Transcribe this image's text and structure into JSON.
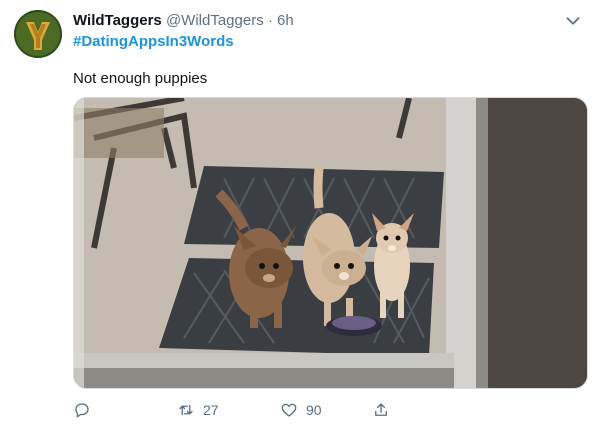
{
  "tweet": {
    "author_name": "WildTaggers",
    "author_handle": "@WildTaggers",
    "separator": "·",
    "time": "6h",
    "hashtag": "#DatingAppsIn3Words",
    "text": "Not enough puppies",
    "media_icon": "photo-of-three-chihuahuas",
    "colors": {
      "link": "#1b95e0",
      "secondary": "#5b7083",
      "primary": "#0f1419"
    }
  },
  "actions": {
    "reply_count": "",
    "retweet_count": "27",
    "like_count": "90",
    "share_count": ""
  }
}
